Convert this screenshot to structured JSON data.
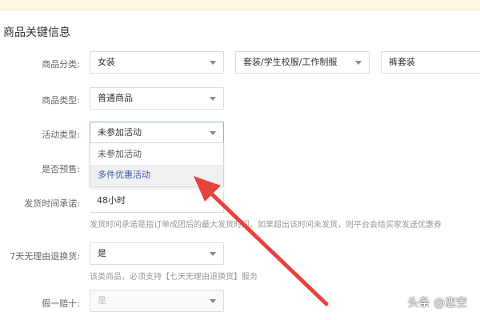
{
  "section": {
    "title": "商品关键信息"
  },
  "category": {
    "label": "商品分类:",
    "level1": "女装",
    "level2": "套装/学生校服/工作制服",
    "level3": "裤套装"
  },
  "product_type": {
    "label": "商品类型:",
    "value": "普通商品"
  },
  "activity_type": {
    "label": "活动类型:",
    "value": "未参加活动",
    "options": [
      "未参加活动",
      "多件优惠活动"
    ]
  },
  "presale": {
    "label": "是否预售:"
  },
  "shipping": {
    "label": "发货时间承诺:",
    "value": "48小时",
    "hint": "发货时间承诺是指订单成团后的最大发货时间。如果超出该时间未发货，则平台会给买家发送优惠券"
  },
  "return_policy": {
    "label": "7天无理由退换货:",
    "value": "是",
    "hint": "该类商品，必须支持【七天无理由退换货】服务"
  },
  "fake_policy": {
    "label": "假一赔十:",
    "value": "是"
  },
  "watermark": {
    "text": "头条 @恋空"
  },
  "colors": {
    "arrow": "#e8423f",
    "focus_border": "#8ab4e8",
    "highlight_text": "#3a5aa8"
  }
}
